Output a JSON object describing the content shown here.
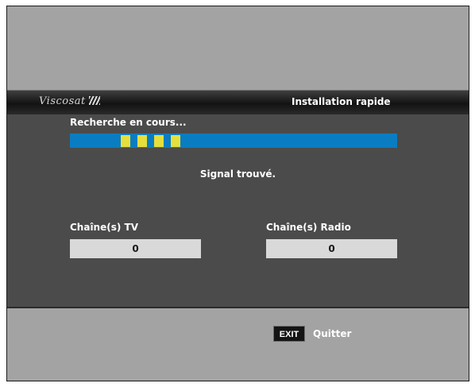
{
  "header": {
    "logo_text": "Viscosat",
    "title": "Installation rapide"
  },
  "search": {
    "status": "Recherche en cours...",
    "progress_segments_lit": 4,
    "signal_message": "Signal trouvé."
  },
  "channels": {
    "tv_label": "Chaîne(s) TV",
    "tv_count": "0",
    "radio_label": "Chaîne(s) Radio",
    "radio_count": "0"
  },
  "footer": {
    "exit_key": "EXIT",
    "exit_label": "Quitter"
  },
  "colors": {
    "progress_track": "#0a7dc2",
    "progress_segment": "#e6de3c",
    "panel": "#4b4b4b",
    "background": "#a3a3a3"
  }
}
